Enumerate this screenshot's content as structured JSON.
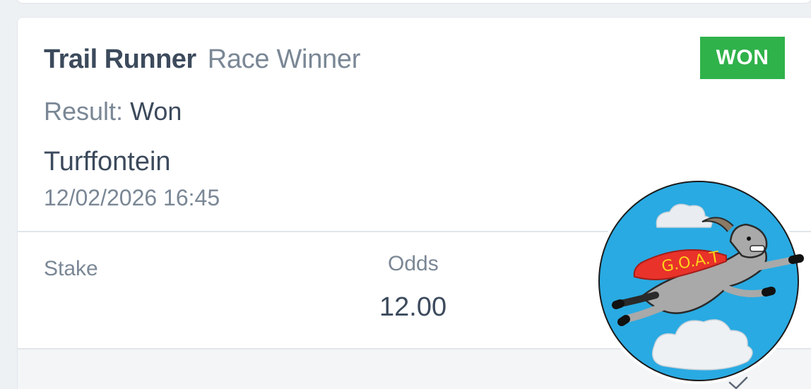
{
  "bet": {
    "selection": "Trail Runner",
    "market": "Race Winner",
    "status_badge": "WON",
    "result_label": "Result:",
    "result_value": "Won",
    "venue": "Turffontein",
    "datetime": "12/02/2026 16:45",
    "stake_label": "Stake",
    "odds_label": "Odds",
    "odds_value": "12.00"
  },
  "mascot": {
    "name": "goat-mascot",
    "cape_text": "G.O.A.T"
  },
  "colors": {
    "won_badge": "#2fb24a",
    "text_primary": "#3c4a5c",
    "text_secondary": "#7a8795",
    "mascot_sky": "#29aae2",
    "cape": "#e8322a"
  },
  "icons": {
    "footer": "check-icon"
  }
}
